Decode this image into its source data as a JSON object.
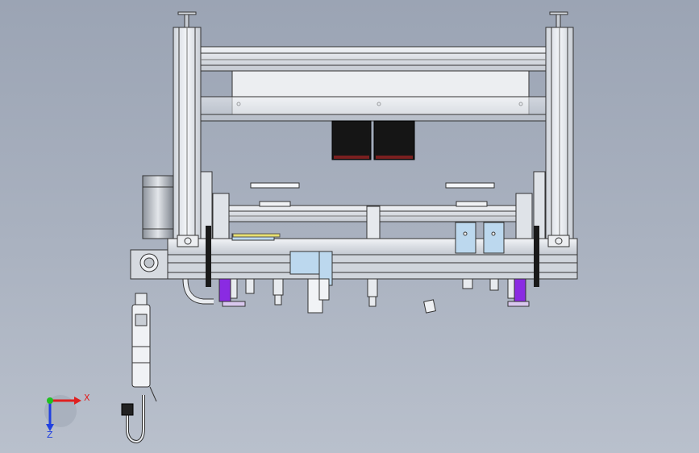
{
  "view": {
    "background_top": "#9ba4b4",
    "background_bottom": "#b9c0cc",
    "frame_color": "#e4e8ee",
    "line_color": "#3a3a3a",
    "motor_color": "#1a1a1a",
    "accent_purple": "#8a2be2",
    "accent_blue": "#bcd8ee",
    "accent_yellow": "#e8e070"
  },
  "triad": {
    "x_label": "X",
    "z_label": "Z",
    "x_color": "#e02020",
    "y_color": "#20c020",
    "z_color": "#2040e0"
  }
}
